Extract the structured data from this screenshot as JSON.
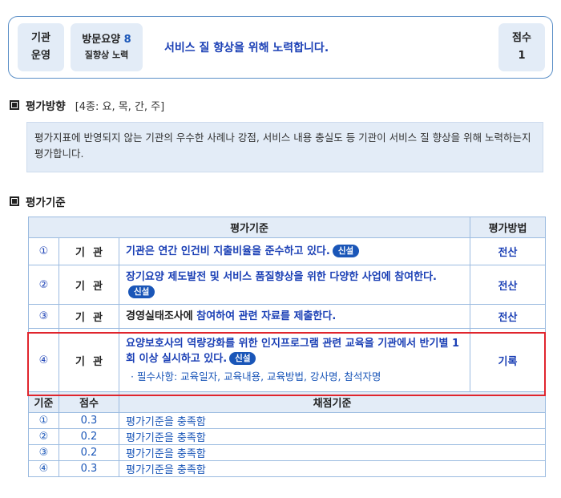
{
  "header": {
    "org_line1": "기관",
    "org_line2": "운영",
    "item_name": "방문요양",
    "item_number": "8",
    "item_sub": "질향상 노력",
    "title": "서비스 질 향상을 위해 노력합니다.",
    "score_label": "점수",
    "score_value": "1"
  },
  "direction": {
    "heading": "평가방향",
    "scope": "[4종: 요, 목, 간, 주]",
    "description": "평가지표에 반영되지 않는 기관의 우수한 사례나 강점, 서비스 내용 충실도 등 기관이 서비스 질 향상을 위해 노력하는지 평가합니다."
  },
  "criteria": {
    "heading": "평가기준",
    "col_criteria": "평가기준",
    "col_method": "평가방법",
    "badge": "신설",
    "rows": [
      {
        "num": "①",
        "category": "기관",
        "text": "기관은 연간 인건비 지출비율을 준수하고 있다.",
        "method": "전산"
      },
      {
        "num": "②",
        "category": "기관",
        "text": "장기요양 제도발전 및 서비스 품질향상을 위한 다양한 사업에 참여한다.",
        "method": "전산"
      },
      {
        "num": "③",
        "category": "기관",
        "text_black": "경영실태조사에",
        "text": "참여하여 관련 자료를 제출한다.",
        "method": "전산"
      },
      {
        "num": "④",
        "category": "기관",
        "text": "요양보호사의 역량강화를 위한 인지프로그램 관련 교육을 기관에서 반기별 1회 이상 실시하고 있다.",
        "note": "· 필수사항: 교육일자, 교육내용, 교육방법, 강사명, 참석자명",
        "method": "기록"
      }
    ]
  },
  "scoring": {
    "col_basis": "기준",
    "col_score": "점수",
    "col_criteria": "채점기준",
    "rows": [
      {
        "num": "①",
        "score": "0.3",
        "text": "평가기준을 충족함"
      },
      {
        "num": "②",
        "score": "0.2",
        "text": "평가기준을 충족함"
      },
      {
        "num": "③",
        "score": "0.2",
        "text": "평가기준을 충족함"
      },
      {
        "num": "④",
        "score": "0.3",
        "text": "평가기준을 충족함"
      }
    ]
  },
  "colors": {
    "accent_blue": "#1a3fb5",
    "highlight_red": "#e0252d",
    "panel_bg": "#e3ecf7"
  }
}
